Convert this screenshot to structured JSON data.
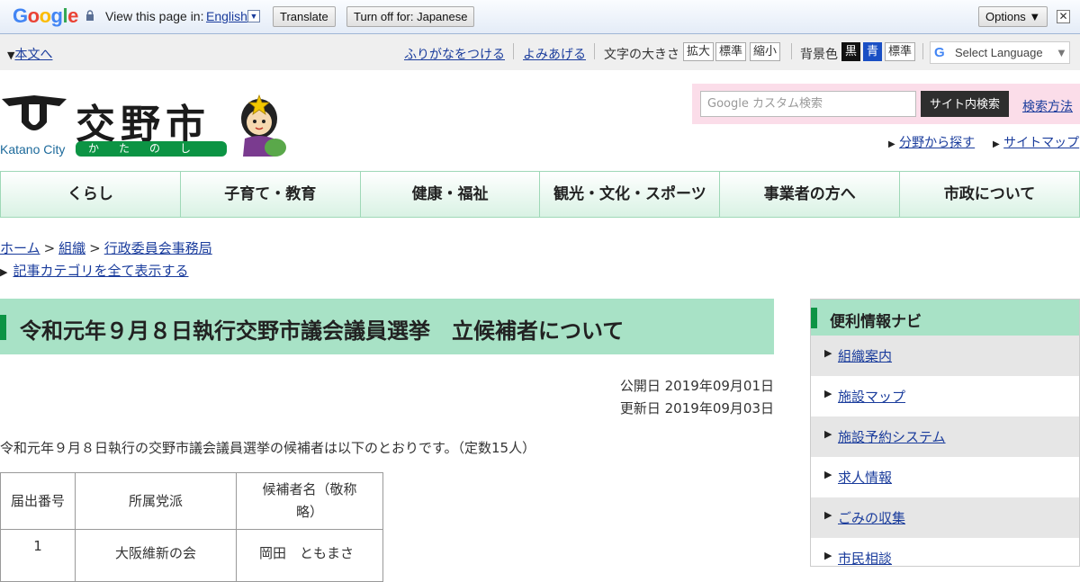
{
  "translate_bar": {
    "logo": "Google",
    "view_in": "View this page in:",
    "language": "English",
    "translate_btn": "Translate",
    "turn_off_btn": "Turn off for: Japanese",
    "options_btn": "Options ▼",
    "close": "✕"
  },
  "util": {
    "skip": "本文へ",
    "furigana": "ふりがなをつける",
    "read_aloud": "よみあげる",
    "text_size_label": "文字の大きさ",
    "size_enlarge": "拡大",
    "size_standard": "標準",
    "size_shrink": "縮小",
    "bg_color_label": "背景色",
    "bg_black": "黒",
    "bg_blue": "青",
    "bg_standard": "標準",
    "select_language": "Select Language"
  },
  "header": {
    "city_name": "交野市",
    "city_kana": "かたのし",
    "city_en": "Katano City",
    "search_placeholder": "Google カスタム検索",
    "search_button": "サイト内検索",
    "search_help": "検索方法",
    "find_by_field": "分野から探す",
    "sitemap": "サイトマップ"
  },
  "nav": [
    {
      "label": "くらし"
    },
    {
      "label": "子育て・教育"
    },
    {
      "label": "健康・福祉"
    },
    {
      "label": "観光・文化・スポーツ"
    },
    {
      "label": "事業者の方へ"
    },
    {
      "label": "市政について"
    }
  ],
  "breadcrumb": {
    "home": "ホーム",
    "org": "組織",
    "dept": "行政委員会事務局",
    "show_categories": "記事カテゴリを全て表示する"
  },
  "article": {
    "title": "令和元年９月８日執行交野市議会議員選挙　立候補者について",
    "published": "公開日 2019年09月01日",
    "updated": "更新日 2019年09月03日",
    "intro": "令和元年９月８日執行の交野市議会議員選挙の候補者は以下のとおりです。（定数15人）",
    "table": {
      "headers": [
        "届出番号",
        "所属党派",
        "候補者名（敬称略）"
      ],
      "rows": [
        [
          "1",
          "大阪維新の会",
          "岡田　ともまさ"
        ]
      ]
    }
  },
  "sidebar": {
    "title": "便利情報ナビ",
    "items": [
      {
        "label": "組織案内"
      },
      {
        "label": "施設マップ"
      },
      {
        "label": "施設予約システム"
      },
      {
        "label": "求人情報"
      },
      {
        "label": "ごみの収集"
      },
      {
        "label": "市民相談"
      }
    ]
  },
  "colors": {
    "accent_green": "#0c9444",
    "title_bg": "#a8e2c6",
    "search_bg": "#fbdde9"
  }
}
